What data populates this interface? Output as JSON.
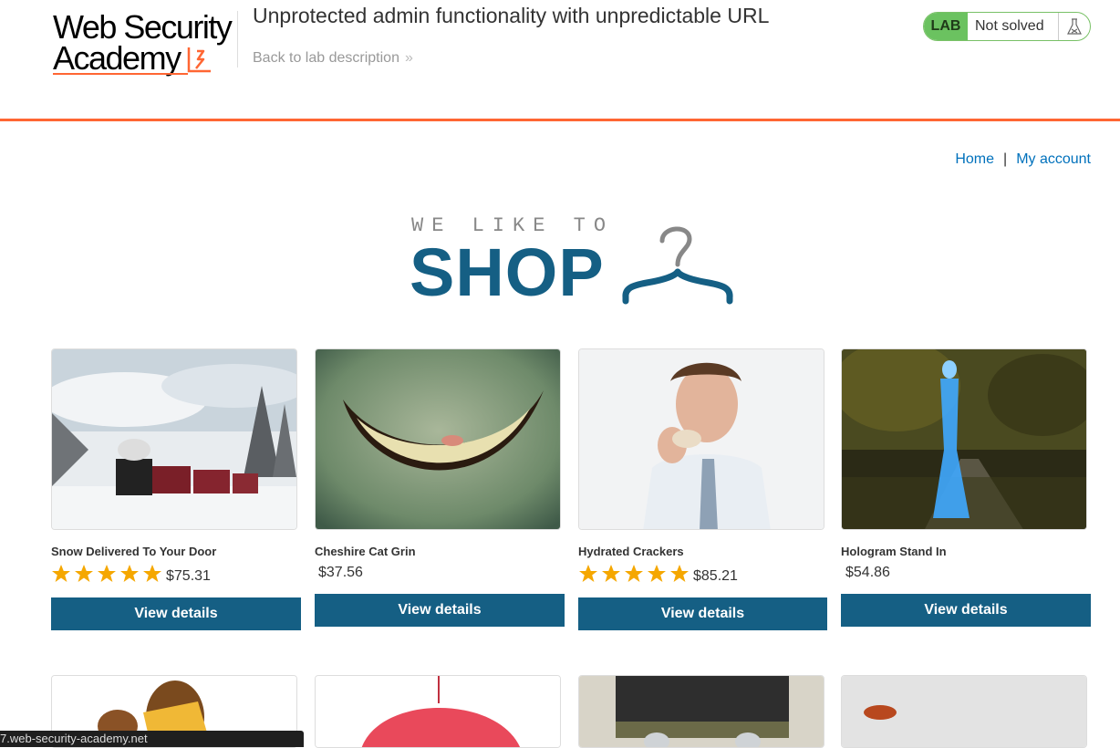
{
  "header": {
    "logo_line1": "Web Security",
    "logo_line2": "Academy",
    "lab_title": "Unprotected admin functionality with unpredictable URL",
    "back_link": "Back to lab description",
    "lab_badge": "LAB",
    "lab_status": "Not solved"
  },
  "nav": {
    "home": "Home",
    "separator": "|",
    "account": "My account"
  },
  "banner": {
    "top": "WE LIKE TO",
    "main": "SHOP"
  },
  "products": [
    {
      "name": "Snow Delivered To Your Door",
      "price": "$75.31",
      "rating": 5,
      "button": "View details"
    },
    {
      "name": "Cheshire Cat Grin",
      "price": "$37.56",
      "rating": 0,
      "button": "View details"
    },
    {
      "name": "Hydrated Crackers",
      "price": "$85.21",
      "rating": 5,
      "button": "View details"
    },
    {
      "name": "Hologram Stand In",
      "price": "$54.86",
      "rating": 0,
      "button": "View details"
    }
  ],
  "second_row_images": [
    "poo-head-product-image",
    "umbrella-product-image",
    "belt-cans-product-image",
    "leaf-product-image"
  ],
  "statusbar": {
    "url": "7.web-security-academy.net"
  },
  "colors": {
    "accent_orange": "#ff6633",
    "button_blue": "#155f84",
    "link_blue": "#0071bc",
    "lab_green": "#6bc260",
    "star": "#f5a700"
  }
}
